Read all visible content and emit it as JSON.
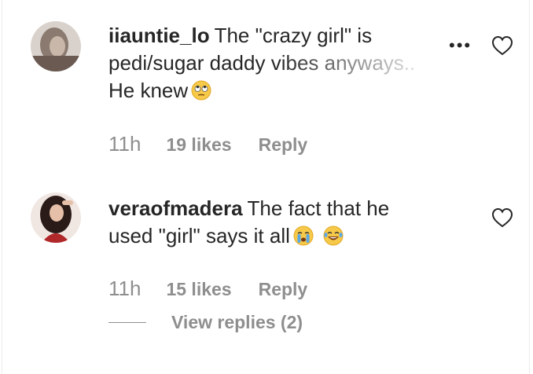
{
  "comments": [
    {
      "username": "iiauntie_lo",
      "text_line1": "The \"crazy girl\" is",
      "text_line2": "pedi/sugar daddy vibes anyways..",
      "text_line3": "He knew",
      "time": "11h",
      "likes": "19 likes",
      "reply_label": "Reply",
      "more_label": "•••",
      "emoji": "rolling-eyes"
    },
    {
      "username": "veraofmadera",
      "text_line1": "The fact that he",
      "text_line2": "used \"girl\" says it all",
      "time": "11h",
      "likes": "15 likes",
      "reply_label": "Reply",
      "emojis": [
        "crying",
        "tears-of-joy"
      ]
    }
  ],
  "view_replies": "View replies (2)"
}
